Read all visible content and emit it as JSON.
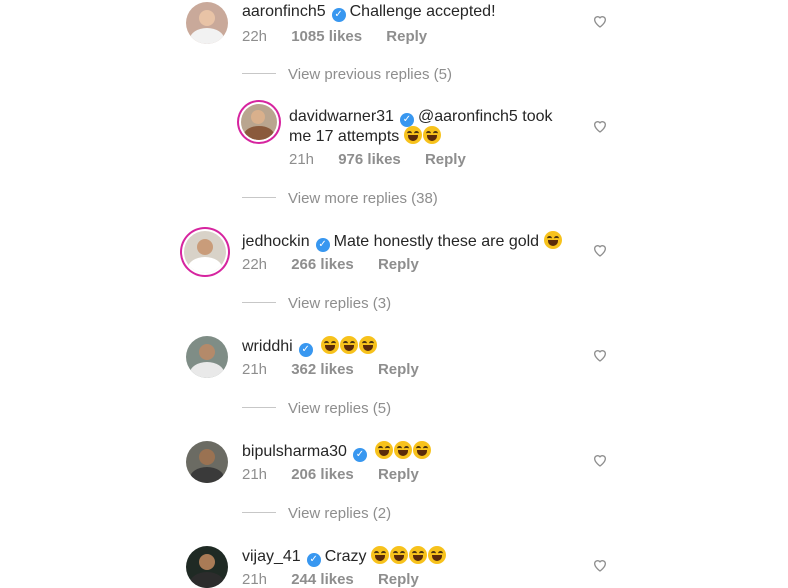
{
  "comments": [
    {
      "username": "aaronfinch5",
      "text": "Challenge accepted!",
      "text2": "",
      "emojis": 0,
      "time": "22h",
      "likes": "1085 likes",
      "reply": "Reply",
      "avatar": {
        "bg": "#c9a99a",
        "head": "#e8c3a6",
        "body": "#f2f2f2"
      }
    },
    {
      "username": "davidwarner31",
      "text": "@aaronfinch5 took",
      "text2": "me 17 attempts",
      "emojis": 2,
      "time": "21h",
      "likes": "976 likes",
      "reply": "Reply",
      "avatar": {
        "bg": "#b9a58f",
        "head": "#d9b08c",
        "body": "#8a5a3c"
      }
    },
    {
      "username": "jedhockin",
      "text": "Mate honestly these are gold",
      "text2": "",
      "emojis": 1,
      "time": "22h",
      "likes": "266 likes",
      "reply": "Reply",
      "avatar": {
        "bg": "#d8d2c8",
        "head": "#c99c7a",
        "body": "#ffffff"
      }
    },
    {
      "username": "wriddhi",
      "text": "",
      "text2": "",
      "emojis": 3,
      "time": "21h",
      "likes": "362 likes",
      "reply": "Reply",
      "avatar": {
        "bg": "#7f8d86",
        "head": "#b48a6a",
        "body": "#e9e9e9"
      }
    },
    {
      "username": "bipulsharma30",
      "text": "",
      "text2": "",
      "emojis": 3,
      "time": "21h",
      "likes": "206 likes",
      "reply": "Reply",
      "avatar": {
        "bg": "#6b6b63",
        "head": "#9a7252",
        "body": "#3a3a3a"
      }
    },
    {
      "username": "vijay_41",
      "text": "Crazy",
      "text2": "",
      "emojis": 4,
      "time": "21h",
      "likes": "244 likes",
      "reply": "Reply",
      "avatar": {
        "bg": "#1f2a24",
        "head": "#a97b56",
        "body": "#2c2c2c"
      }
    }
  ],
  "reply_links": {
    "previous": "View previous replies (5)",
    "more": "View more replies (38)",
    "r3": "View replies (3)",
    "r5": "View replies (5)",
    "r2": "View replies (2)"
  },
  "colors": {
    "verified": "#3897f0",
    "story_ring": "#d6249f",
    "muted": "#8e8e8e"
  },
  "icons": {
    "like": "heart-outline-icon",
    "verified": "verified-badge-icon",
    "emoji": "face-with-tears-of-joy"
  }
}
